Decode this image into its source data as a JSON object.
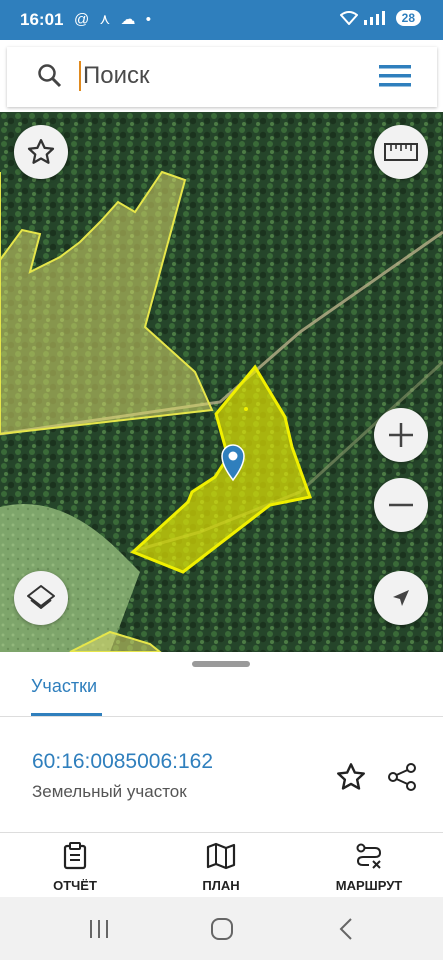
{
  "status_bar": {
    "time": "16:01",
    "left_icons": "@ ⋏ ☁ •",
    "signal": "📶",
    "battery": "28"
  },
  "search": {
    "placeholder": "Поиск"
  },
  "map": {
    "parcel_color": "#f0f000",
    "marker_color": "#2f7fbd"
  },
  "sheet": {
    "tab_label": "Участки",
    "parcel": {
      "cadastral_number": "60:16:0085006:162",
      "type": "Земельный участок"
    }
  },
  "bottom_nav": {
    "report": "ОТЧЁТ",
    "plan": "ПЛАН",
    "route": "МАРШРУТ"
  },
  "colors": {
    "accent": "#2f7fbd"
  }
}
